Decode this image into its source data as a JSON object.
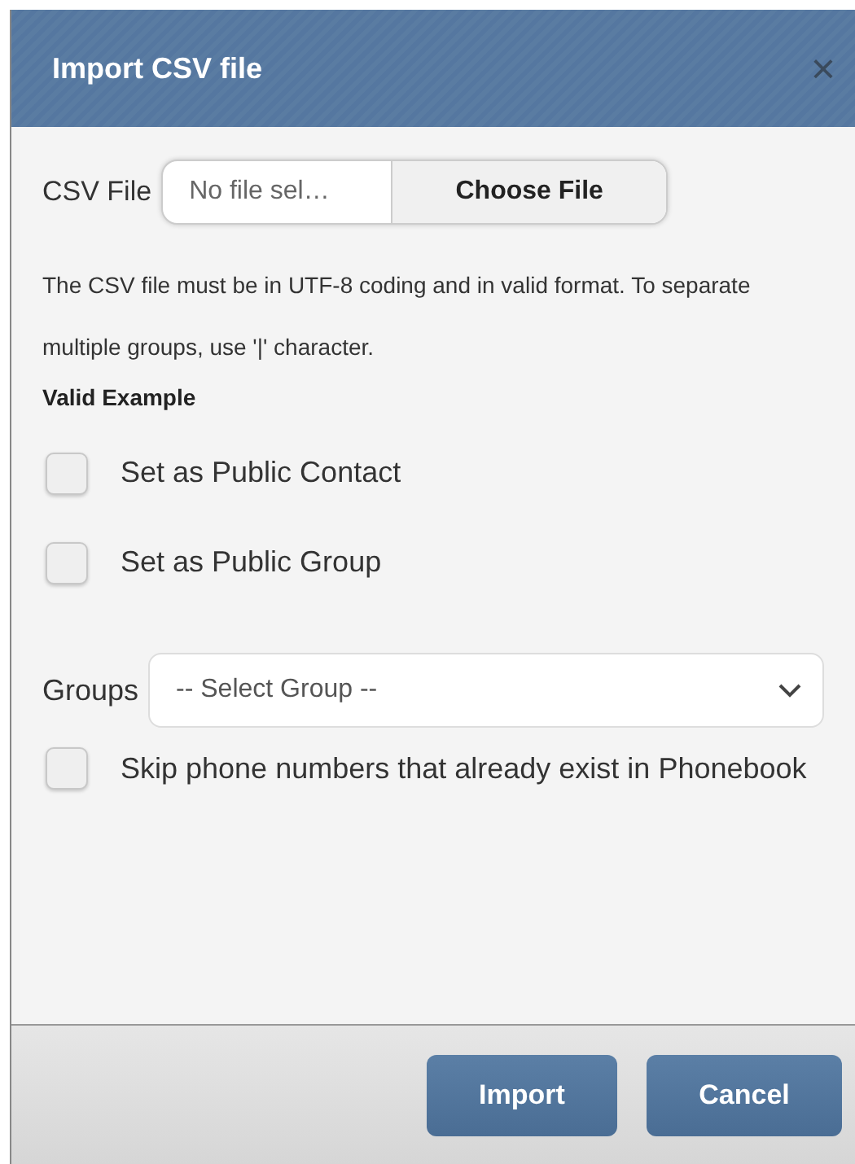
{
  "dialog": {
    "title": "Import CSV file",
    "close": "×"
  },
  "file": {
    "label": "CSV File",
    "status": "No file sel…",
    "button": "Choose File"
  },
  "note": "The CSV file must be in UTF-8 coding and in valid format. To separate multiple groups, use '|' character.",
  "example": "Valid Example",
  "options": [
    {
      "label": "Set as Public Contact",
      "checked": false
    },
    {
      "label": "Set as Public Group",
      "checked": false
    }
  ],
  "groups": {
    "label": "Groups",
    "placeholder": "-- Select Group --"
  },
  "skip": {
    "label": "Skip phone numbers that already exist in Phonebook",
    "checked": false
  },
  "buttons": [
    "Import",
    "Cancel"
  ]
}
